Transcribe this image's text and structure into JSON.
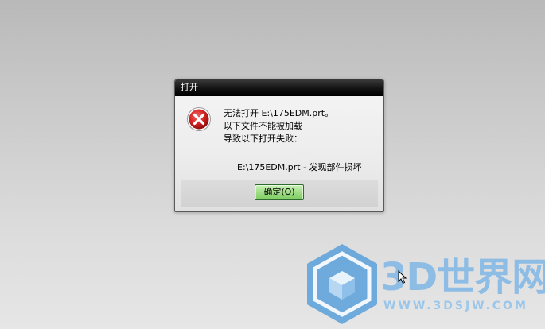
{
  "dialog": {
    "title": "打开",
    "icon": "error-icon",
    "message_lines": [
      "无法打开 E:\\175EDM.prt。",
      "以下文件不能被加载",
      "导致以下打开失败："
    ],
    "detail": "E:\\175EDM.prt - 发现部件损坏",
    "ok_button_label": "确定(O)"
  },
  "watermark": {
    "brand": "3D世界网",
    "url": "WWW.3DSJW.COM"
  },
  "colors": {
    "titlebar": "#000000",
    "error_red": "#d42020",
    "ok_button_green": "#9fdc86",
    "watermark_blue": "#7fb7e6"
  }
}
